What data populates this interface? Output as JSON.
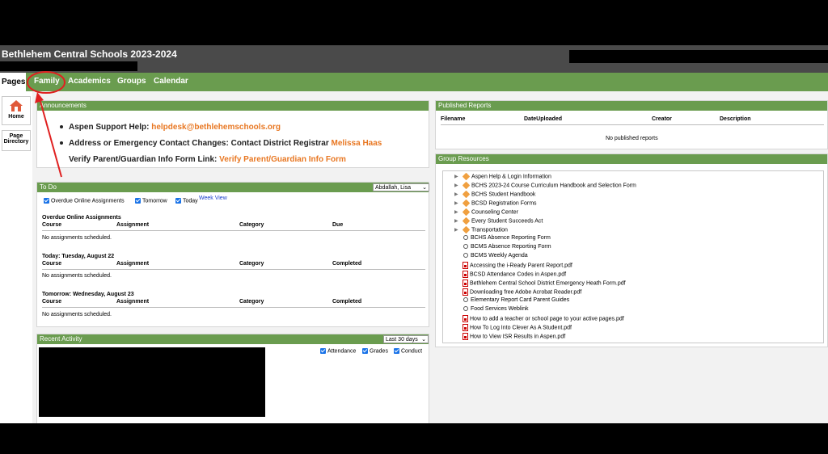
{
  "header": {
    "title": "Bethlehem Central Schools 2023-2024"
  },
  "nav": {
    "pages": "Pages",
    "tabs": [
      "Family",
      "Academics",
      "Groups",
      "Calendar"
    ]
  },
  "sidebar": {
    "home": "Home",
    "page_directory_1": "Page",
    "page_directory_2": "Directory"
  },
  "announcements": {
    "title": "Announcements",
    "support_label": "Aspen Support Help:",
    "support_value": "helpdesk@bethlehemschools.org",
    "contact_label": "Address or Emergency Contact Changes: Contact District Registrar",
    "contact_value": "Melissa Haas",
    "verify_label": "Verify Parent/Guardian Info Form Link:",
    "verify_value": "Verify Parent/Guardian Info Form"
  },
  "todo": {
    "title": "To Do",
    "student_select": "Abdallah, Lisa",
    "filters": [
      "Overdue Online Assignments",
      "Tomorrow",
      "Today"
    ],
    "week_view": "Week View",
    "columns_due": [
      "Course",
      "Assignment",
      "Category",
      "Due"
    ],
    "columns_completed": [
      "Course",
      "Assignment",
      "Category",
      "Completed"
    ],
    "sections": [
      {
        "title": "Overdue Online Assignments",
        "empty": "No assignments scheduled."
      },
      {
        "title": "Today: Tuesday, August 22",
        "empty": "No assignments scheduled."
      },
      {
        "title": "Tomorrow: Wednesday, August 23",
        "empty": "No assignments scheduled."
      }
    ]
  },
  "recent_activity": {
    "title": "Recent Activity",
    "range_select": "Last 30 days",
    "filters": [
      "Attendance",
      "Grades",
      "Conduct"
    ]
  },
  "published_reports": {
    "title": "Published Reports",
    "columns": [
      "Filename",
      "DateUploaded",
      "Creator",
      "Description"
    ],
    "empty": "No published reports"
  },
  "group_resources": {
    "title": "Group Resources",
    "items": [
      {
        "label": "Aspen Help & Login Information",
        "icon": "folder-icon"
      },
      {
        "label": "BCHS 2023-24 Course Curriculum Handbook and Selection Form",
        "icon": "folder-icon"
      },
      {
        "label": "BCHS Student Handbook",
        "icon": "folder-icon"
      },
      {
        "label": "BCSD Registration Forms",
        "icon": "folder-icon"
      },
      {
        "label": "Counseling Center",
        "icon": "folder-icon"
      },
      {
        "label": "Every Student Succeeds Act",
        "icon": "folder-icon"
      },
      {
        "label": "Transportation",
        "icon": "folder-icon"
      },
      {
        "label": "BCHS Absence Reporting Form",
        "icon": "link-icon"
      },
      {
        "label": "BCMS Absence Reporting Form",
        "icon": "link-icon"
      },
      {
        "label": "BCMS Weekly Agenda",
        "icon": "link-icon"
      },
      {
        "label": "Accessing the i-Ready Parent Report.pdf",
        "icon": "pdf-icon"
      },
      {
        "label": "BCSD Attendance Codes in Aspen.pdf",
        "icon": "pdf-icon"
      },
      {
        "label": "Bethlehem Central School District Emergency Heath Form.pdf",
        "icon": "pdf-icon"
      },
      {
        "label": "Downloading free Adobe Acrobat Reader.pdf",
        "icon": "pdf-icon"
      },
      {
        "label": "Elementary Report Card Parent Guides",
        "icon": "link-icon"
      },
      {
        "label": "Food Services Weblink",
        "icon": "link-icon"
      },
      {
        "label": "How to add a teacher or school page to your active pages.pdf",
        "icon": "pdf-icon"
      },
      {
        "label": "How To Log Into Clever As A Student.pdf",
        "icon": "pdf-icon"
      },
      {
        "label": "How to View ISR Results in Aspen.pdf",
        "icon": "pdf-icon"
      }
    ]
  },
  "colors": {
    "nav_green": "#6a9c4f",
    "link_orange": "#e87722",
    "annotation_red": "#e02020"
  }
}
